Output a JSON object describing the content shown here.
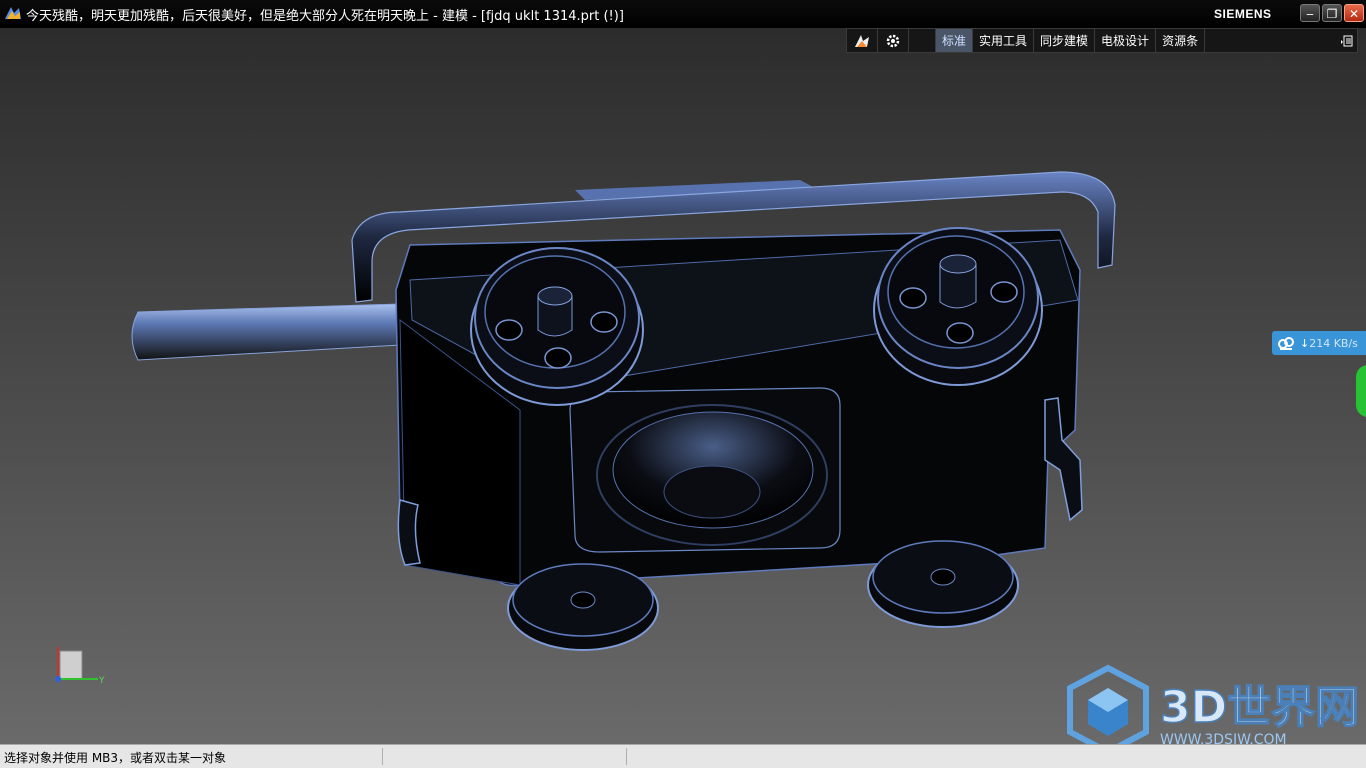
{
  "window": {
    "title": "今天残酷，明天更加残酷，后天很美好，但是绝大部分人死在明天晚上 - 建模 - [fjdq uklt 1314.prt   (!)]",
    "brand": "SIEMENS",
    "minimize": "‒",
    "restore": "❐",
    "close": "✕"
  },
  "ribbon": {
    "tabs": [
      {
        "label": "标准",
        "active": true
      },
      {
        "label": "实用工具",
        "active": false
      },
      {
        "label": "同步建模",
        "active": false
      },
      {
        "label": "电极设计",
        "active": false
      },
      {
        "label": "资源条",
        "active": false
      }
    ]
  },
  "download": {
    "speed": "214 KB/s"
  },
  "triad": {
    "y_label": "Y"
  },
  "watermark": {
    "text": "3D世界网",
    "url": "WWW.3DSJW.COM"
  },
  "status": {
    "prompt": "选择对象并使用 MB3，或者双击某一对象"
  },
  "colors": {
    "accent": "#3a94d8",
    "part_edge": "#7d9ed8",
    "brand": "#ffffff"
  }
}
